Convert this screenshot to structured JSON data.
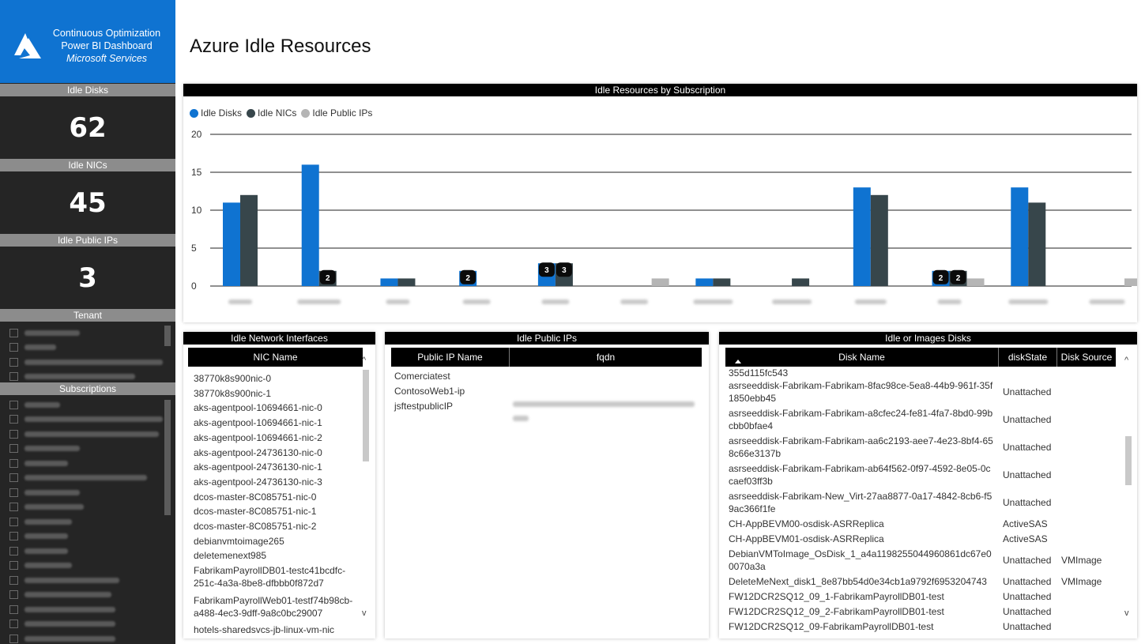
{
  "brand": {
    "line1": "Continuous Optimization",
    "line2": "Power BI Dashboard",
    "line3": "Microsoft Services"
  },
  "page_title": "Azure Idle Resources",
  "kpis": [
    {
      "label": "Idle Disks",
      "value": "62"
    },
    {
      "label": "Idle NICs",
      "value": "45"
    },
    {
      "label": "Idle Public IPs",
      "value": "3"
    }
  ],
  "filters": {
    "tenant_label": "Tenant",
    "subscriptions_label": "Subscriptions"
  },
  "chart_panel_title": "Idle Resources by Subscription",
  "chart_data": {
    "type": "bar",
    "title": "Idle Resources by Subscription",
    "ylim": [
      0,
      20
    ],
    "yticks": [
      0,
      5,
      10,
      15,
      20
    ],
    "categories": [
      "",
      "",
      "",
      "",
      "",
      "",
      "",
      "",
      "",
      "",
      "",
      ""
    ],
    "series": [
      {
        "name": "Idle Disks",
        "color": "#0f73d1",
        "values": [
          11,
          16,
          1,
          2,
          3,
          0,
          1,
          0,
          13,
          2,
          13,
          0
        ]
      },
      {
        "name": "Idle NICs",
        "color": "#37464b",
        "values": [
          12,
          2,
          1,
          0,
          3,
          0,
          1,
          1,
          12,
          2,
          11,
          0
        ]
      },
      {
        "name": "Idle Public IPs",
        "color": "#b5b5b5",
        "values": [
          0,
          0,
          0,
          0,
          0,
          1,
          0,
          0,
          0,
          1,
          0,
          1
        ]
      }
    ],
    "data_labels": [
      {
        "category": 1,
        "series": 1,
        "text": "2"
      },
      {
        "category": 3,
        "series": 0,
        "text": "2"
      },
      {
        "category": 4,
        "series": 0,
        "text": "3"
      },
      {
        "category": 4,
        "series": 1,
        "text": "3"
      },
      {
        "category": 9,
        "series": 0,
        "text": "2"
      },
      {
        "category": 9,
        "series": 1,
        "text": "2"
      }
    ],
    "legend_position": "top-left",
    "grid": true
  },
  "nic_table": {
    "title": "Idle Network Interfaces",
    "header": "NIC Name",
    "rows": [
      "38770k8s900nic-0",
      "38770k8s900nic-1",
      "aks-agentpool-10694661-nic-0",
      "aks-agentpool-10694661-nic-1",
      "aks-agentpool-10694661-nic-2",
      "aks-agentpool-24736130-nic-0",
      "aks-agentpool-24736130-nic-1",
      "aks-agentpool-24736130-nic-3",
      "dcos-master-8C085751-nic-0",
      "dcos-master-8C085751-nic-1",
      "dcos-master-8C085751-nic-2",
      "debianvmtoimage265",
      "deletemenext985",
      "FabrikamPayrollDB01-testc41bcdfc-251c-4a3a-8be8-dfbbb0f872d7",
      "FabrikamPayrollWeb01-testf74b98cb-a488-4ec3-9dff-9a8c0bc29007",
      "hotels-sharedsvcs-jb-linux-vm-nic"
    ]
  },
  "ip_table": {
    "title": "Idle Public IPs",
    "col1": "Public IP Name",
    "col2": "fqdn",
    "rows": [
      "Comerciatest",
      "ContosoWeb1-ip",
      "jsftestpublicIP"
    ]
  },
  "disk_table": {
    "title": "Idle or Images Disks",
    "col1": "Disk Name",
    "col2": "diskState",
    "col3": "Disk Source",
    "rows": [
      {
        "name": "355d115fc543",
        "state": "",
        "source": ""
      },
      {
        "name": "asrseeddisk-Fabrikam-Fabrikam-8fac98ce-5ea8-44b9-961f-35f1850ebb45",
        "state": "Unattached",
        "source": ""
      },
      {
        "name": "asrseeddisk-Fabrikam-Fabrikam-a8cfec24-fe81-4fa7-8bd0-99bcbb0bfae4",
        "state": "Unattached",
        "source": ""
      },
      {
        "name": "asrseeddisk-Fabrikam-Fabrikam-aa6c2193-aee7-4e23-8bf4-658c66e3137b",
        "state": "Unattached",
        "source": ""
      },
      {
        "name": "asrseeddisk-Fabrikam-Fabrikam-ab64f562-0f97-4592-8e05-0ccaef03ff3b",
        "state": "Unattached",
        "source": ""
      },
      {
        "name": "asrseeddisk-Fabrikam-New_Virt-27aa8877-0a17-4842-8cb6-f59ac366f1fe",
        "state": "Unattached",
        "source": ""
      },
      {
        "name": "CH-AppBEVM00-osdisk-ASRReplica",
        "state": "ActiveSAS",
        "source": ""
      },
      {
        "name": "CH-AppBEVM01-osdisk-ASRReplica",
        "state": "ActiveSAS",
        "source": ""
      },
      {
        "name": "DebianVMToImage_OsDisk_1_a4a1198255044960861dc67e00070a3a",
        "state": "Unattached",
        "source": "VMImage"
      },
      {
        "name": "DeleteMeNext_disk1_8e87bb54d0e34cb1a9792f6953204743",
        "state": "Unattached",
        "source": "VMImage"
      },
      {
        "name": "FW12DCR2SQ12_09_1-FabrikamPayrollDB01-test",
        "state": "Unattached",
        "source": ""
      },
      {
        "name": "FW12DCR2SQ12_09_2-FabrikamPayrollDB01-test",
        "state": "Unattached",
        "source": ""
      },
      {
        "name": "FW12DCR2SQ12_09-FabrikamPayrollDB01-test",
        "state": "Unattached",
        "source": ""
      }
    ]
  },
  "colors": {
    "accent": "#0f73d1",
    "sidebar": "#252525",
    "header_gray": "#8c8c8c"
  }
}
